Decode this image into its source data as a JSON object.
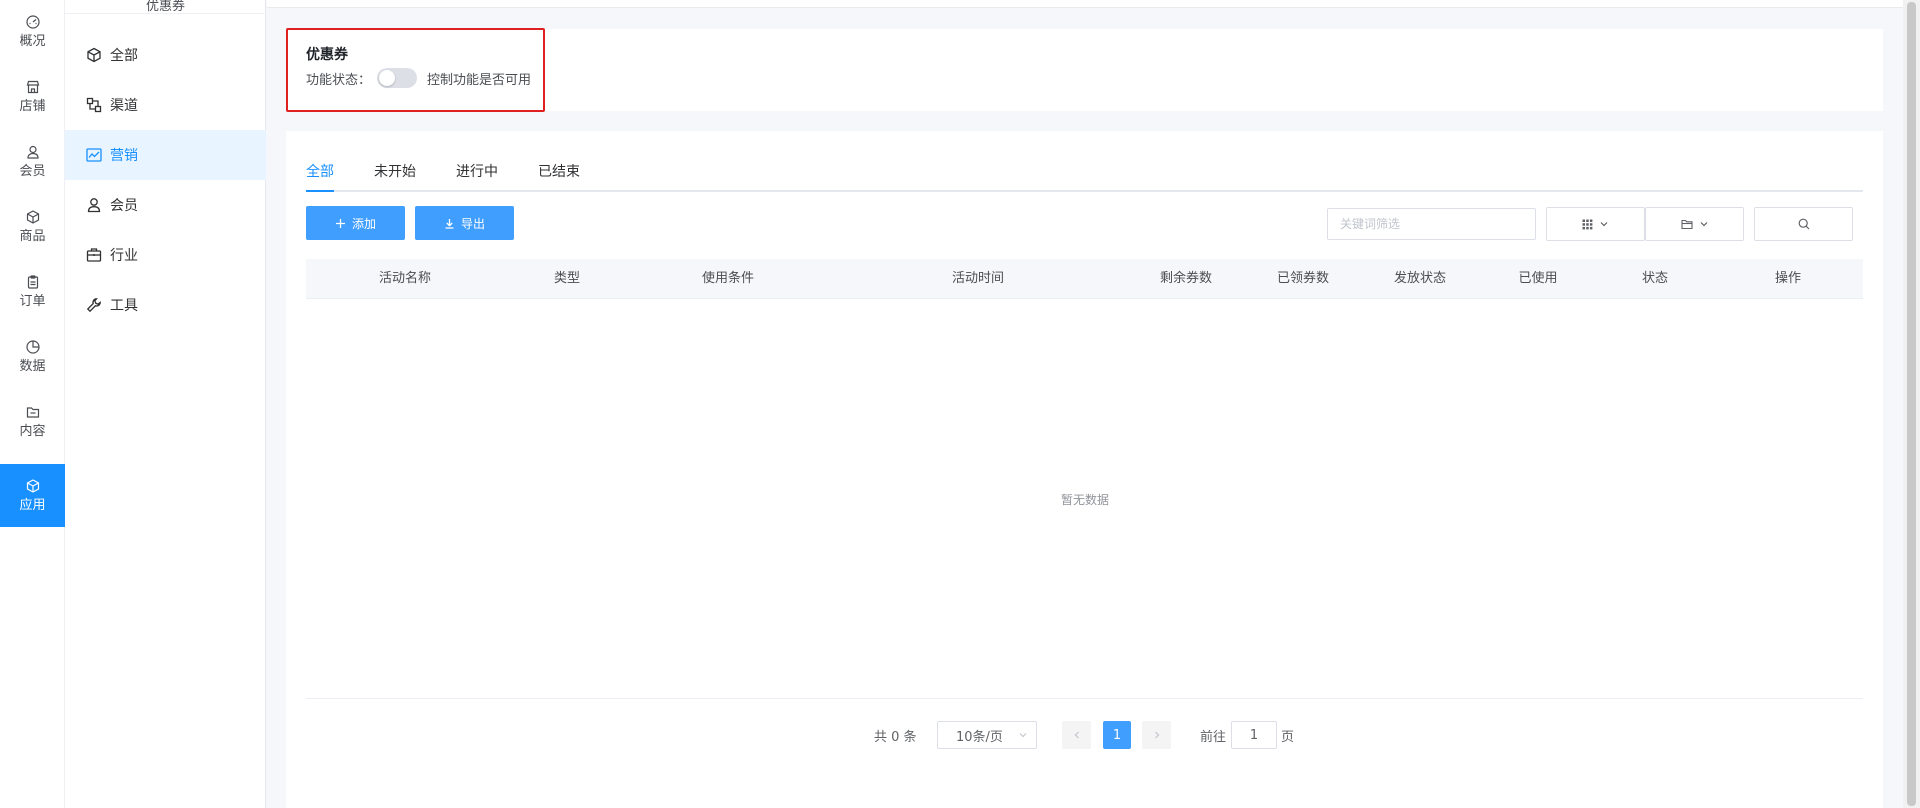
{
  "rail": {
    "items": [
      {
        "label": "概况",
        "icon": "dashboard-icon",
        "active": false
      },
      {
        "label": "店铺",
        "icon": "store-icon",
        "active": false
      },
      {
        "label": "会员",
        "icon": "user-icon",
        "active": false
      },
      {
        "label": "商品",
        "icon": "box-icon",
        "active": false
      },
      {
        "label": "订单",
        "icon": "clipboard-icon",
        "active": false
      },
      {
        "label": "数据",
        "icon": "pie-chart-icon",
        "active": false
      },
      {
        "label": "内容",
        "icon": "folder-icon",
        "active": false
      },
      {
        "label": "应用",
        "icon": "cube-icon",
        "active": true
      }
    ]
  },
  "menu": {
    "header": "优惠券",
    "items": [
      {
        "label": "全部",
        "icon": "cube-icon",
        "active": false
      },
      {
        "label": "渠道",
        "icon": "channel-icon",
        "active": false
      },
      {
        "label": "营销",
        "icon": "trend-chart-icon",
        "active": true
      },
      {
        "label": "会员",
        "icon": "user-icon",
        "active": false
      },
      {
        "label": "行业",
        "icon": "briefcase-icon",
        "active": false
      },
      {
        "label": "工具",
        "icon": "wrench-icon",
        "active": false
      }
    ]
  },
  "feature": {
    "title": "优惠券",
    "status_label": "功能状态：",
    "toggle_on": false,
    "description": "控制功能是否可用"
  },
  "tabs": [
    {
      "label": "全部",
      "active": true
    },
    {
      "label": "未开始",
      "active": false
    },
    {
      "label": "进行中",
      "active": false
    },
    {
      "label": "已结束",
      "active": false
    }
  ],
  "toolbar": {
    "add_label": "添加",
    "export_label": "导出",
    "search_placeholder": "关键词筛选",
    "view_select_icon": "grid-icon",
    "folder_select_icon": "folder-icon",
    "search_button_icon": "search-icon"
  },
  "table": {
    "columns": [
      "活动名称",
      "类型",
      "使用条件",
      "活动时间",
      "剩余券数",
      "已领券数",
      "发放状态",
      "已使用",
      "状态",
      "操作"
    ],
    "rows": [],
    "empty_text": "暂无数据"
  },
  "pagination": {
    "total_text": "共 0 条",
    "page_size": "10条/页",
    "current_page": "1",
    "goto_label": "前往",
    "goto_value": "1",
    "goto_unit": "页"
  },
  "colors": {
    "primary": "#409eff",
    "active_nav": "#1890ff",
    "highlight_border": "#e02020"
  }
}
